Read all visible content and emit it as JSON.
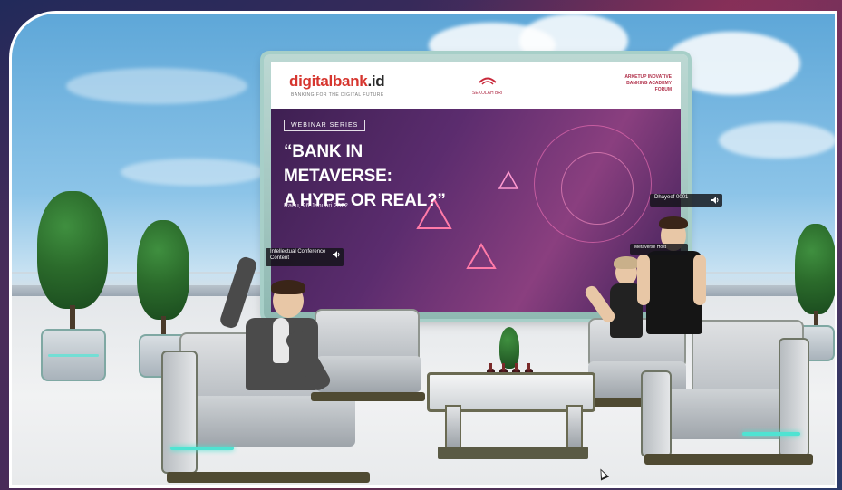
{
  "screen": {
    "brand": "digitalbank",
    "brand_suffix": ".id",
    "brand_tagline": "BANKING FOR THE DIGITAL FUTURE",
    "partner_name": "SEKOLAH BRI",
    "header_right": "ARKETUP INOVATIVE BANKING ACADEMY FORUM",
    "webinar_tag": "WEBINAR SERIES",
    "headline_line1": "“BANK IN METAVERSE:",
    "headline_line2": "A HYPE OR REAL?”",
    "date": "Rabu, 26 Januari 2022"
  },
  "nametags": {
    "left": "Intellectual Conference Content",
    "right": "Dhayeef 0001",
    "presenter": "Metaverse Host"
  },
  "icons": {
    "speaker": "speaker-icon",
    "cursor": "mouse-cursor-icon"
  },
  "colors": {
    "brand_red": "#d6362f",
    "screen_purple": "#5b2c6e",
    "accent_teal": "#4fe3d2",
    "sky": "#8cc4e8"
  }
}
